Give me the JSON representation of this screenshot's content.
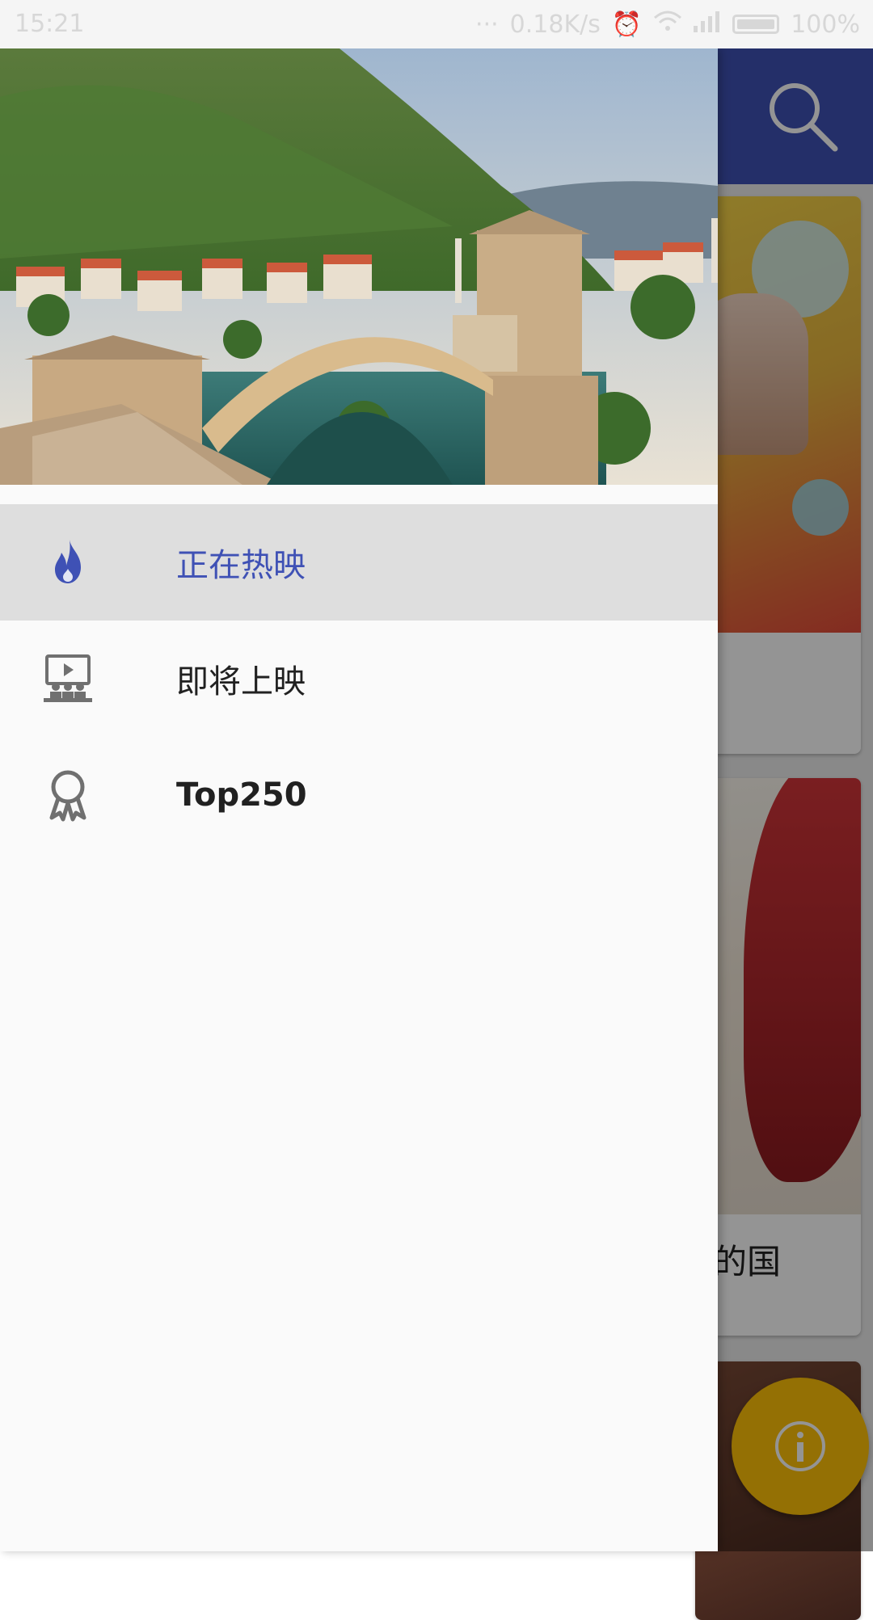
{
  "status_bar": {
    "time": "15:21",
    "network_speed": "0.18K/s",
    "battery": "100%"
  },
  "background_app": {
    "toolbar_color": "#3f51b5",
    "search_icon": "search-icon",
    "movie_title_fragment": "的国",
    "fab_icon": "info-icon",
    "fab_color": "#ffc107"
  },
  "drawer": {
    "header_image": "mostar-old-bridge-landscape",
    "accent_color": "#3f51b5",
    "items": [
      {
        "label": "正在热映",
        "icon": "fire-icon",
        "active": true
      },
      {
        "label": "即将上映",
        "icon": "cinema-icon",
        "active": false
      },
      {
        "label": "Top250",
        "icon": "award-icon",
        "active": false
      }
    ]
  }
}
